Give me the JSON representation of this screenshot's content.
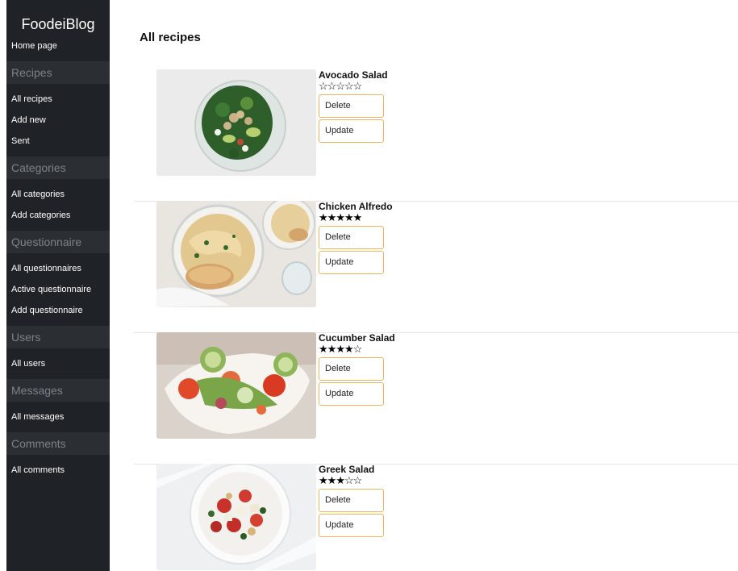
{
  "brand": "FoodeiBlog",
  "sidebar": {
    "home": "Home page",
    "sections": [
      {
        "heading": "Recipes",
        "items": [
          "All recipes",
          "Add new",
          "Sent"
        ]
      },
      {
        "heading": "Categories",
        "items": [
          "All categories",
          "Add categories"
        ]
      },
      {
        "heading": "Questionnaire",
        "items": [
          "All questionnaires",
          "Active questionnaire",
          "Add questionnaire"
        ]
      },
      {
        "heading": "Users",
        "items": [
          "All users"
        ]
      },
      {
        "heading": "Messages",
        "items": [
          "All messages"
        ]
      },
      {
        "heading": "Comments",
        "items": [
          "All comments"
        ]
      }
    ]
  },
  "main": {
    "title": "All recipes",
    "delete_label": "Delete",
    "update_label": "Update",
    "recipes": [
      {
        "name": "Avocado Salad",
        "rating": 0,
        "max_rating": 5,
        "image": "avocado-salad-photo"
      },
      {
        "name": "Chicken Alfredo",
        "rating": 5,
        "max_rating": 5,
        "image": "chicken-alfredo-photo"
      },
      {
        "name": "Cucumber Salad",
        "rating": 4,
        "max_rating": 5,
        "image": "cucumber-salad-photo"
      },
      {
        "name": "Greek Salad",
        "rating": 3,
        "max_rating": 5,
        "image": "greek-salad-photo"
      }
    ]
  },
  "colors": {
    "sidebar_bg": "#1f2226",
    "sidebar_heading_bg": "#2b2f34",
    "sidebar_heading_text": "#7d8289",
    "button_border": "#f0b45a"
  }
}
